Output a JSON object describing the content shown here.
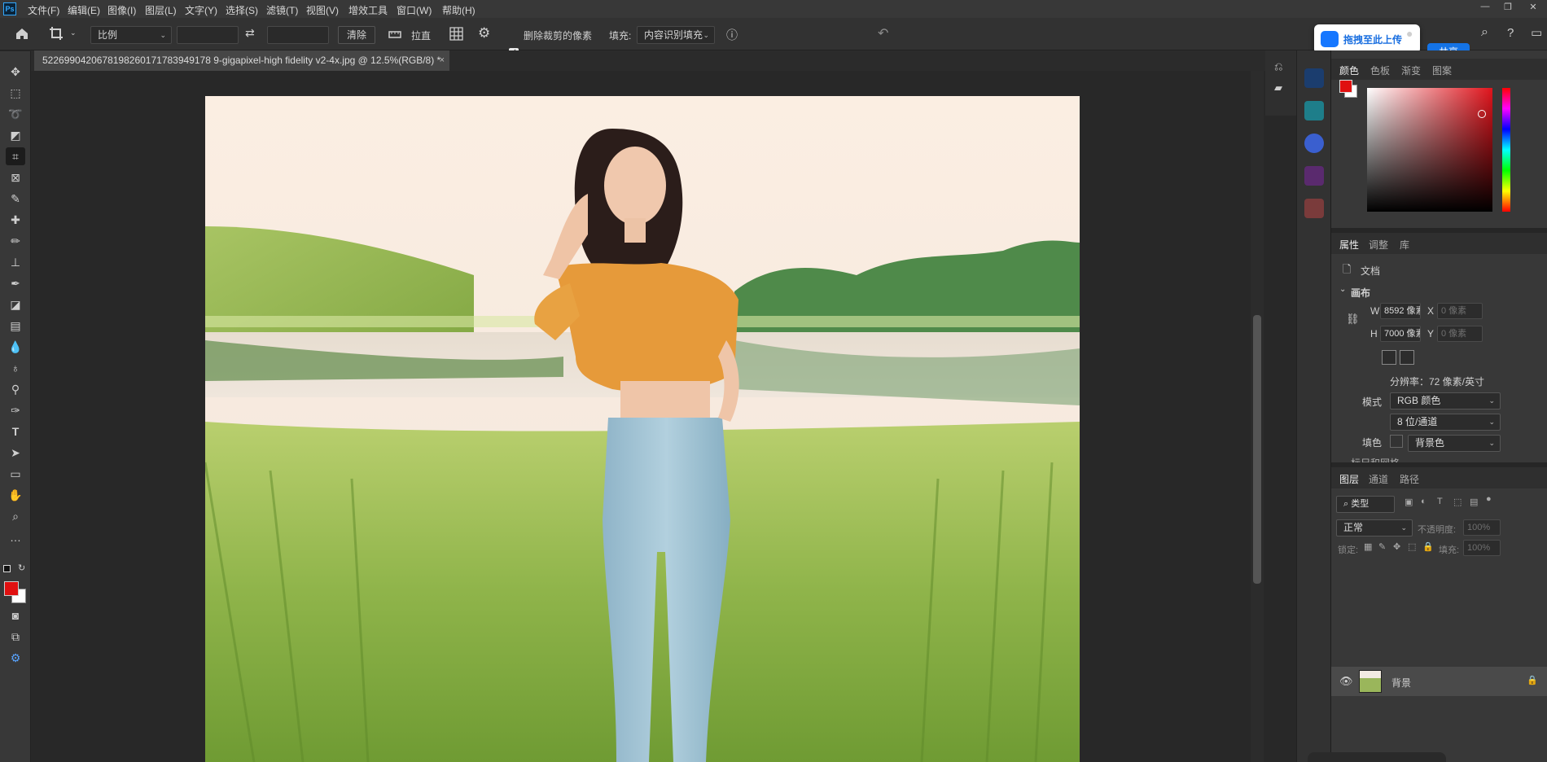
{
  "app": {
    "logo": "Ps"
  },
  "menu": [
    "文件(F)",
    "编辑(E)",
    "图像(I)",
    "图层(L)",
    "文字(Y)",
    "选择(S)",
    "滤镜(T)",
    "视图(V)",
    "增效工具",
    "窗口(W)",
    "帮助(H)"
  ],
  "window_controls": {
    "minimize": "—",
    "restore": "❐",
    "close": "✕"
  },
  "options": {
    "ratio_select": "比例",
    "clear_button": "清除",
    "straighten_label": "拉直",
    "delete_cropped_label": "删除裁剪的像素",
    "delete_cropped_checked": true,
    "fill_label": "填充:",
    "fill_select": "内容识别填充",
    "upload_label": "拖拽至此上传",
    "share_label": "共享"
  },
  "document": {
    "tab_title": "5226990420678198260171783949178 9-gigapixel-high fidelity v2-4x.jpg @ 12.5%(RGB/8) *",
    "close": "×"
  },
  "color_panel": {
    "tabs": [
      "颜色",
      "色板",
      "渐变",
      "图案"
    ],
    "active_tab": "颜色",
    "foreground": "#e01010",
    "background": "#ffffff"
  },
  "properties_panel": {
    "tabs": [
      "属性",
      "调整",
      "库"
    ],
    "active_tab": "属性",
    "doc_label": "文档",
    "section_canvas": "画布",
    "w_label": "W",
    "w_value": "8592 像素",
    "h_label": "H",
    "h_value": "7000 像素",
    "x_label": "X",
    "x_placeholder": "0 像素",
    "y_label": "Y",
    "y_placeholder": "0 像素",
    "resolution": "分辨率：72 像素/英寸",
    "mode_label": "模式",
    "mode_value": "RGB 颜色",
    "depth_value": "8 位/通道",
    "fill_label": "填色",
    "fill_value": "背景色",
    "next_section": "标尺和网格"
  },
  "layers_panel": {
    "tabs": [
      "图层",
      "通道",
      "路径"
    ],
    "active_tab": "图层",
    "filter_placeholder": "类型",
    "blend_mode": "正常",
    "opacity_label": "不透明度:",
    "opacity_value": "100%",
    "lock_label": "锁定:",
    "fill_label": "填充:",
    "fill_value": "100%",
    "layers": [
      {
        "name": "背景",
        "visible": true,
        "locked": true
      }
    ]
  }
}
